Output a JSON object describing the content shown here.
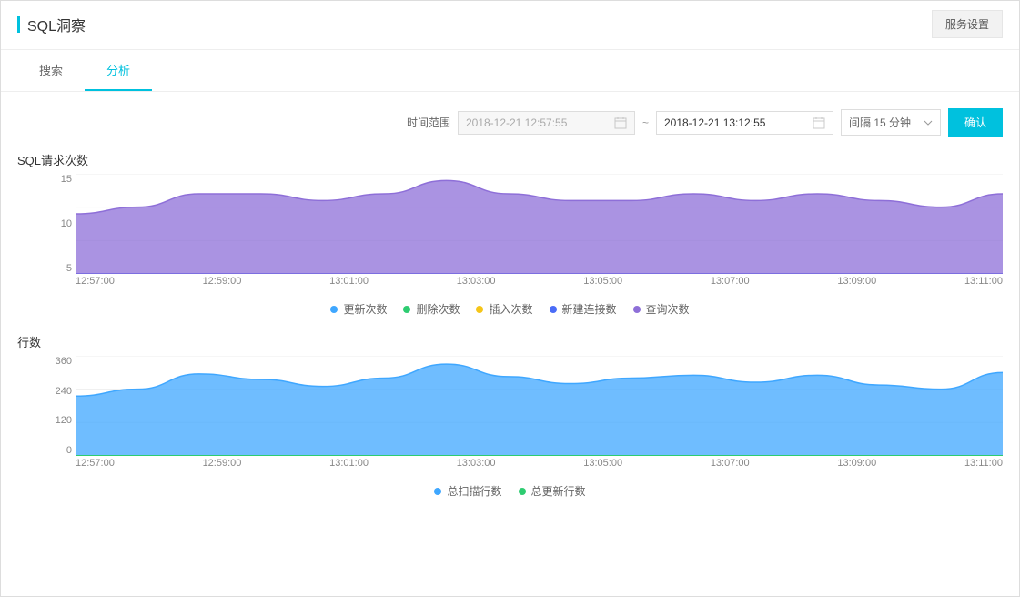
{
  "header": {
    "title": "SQL洞察",
    "service_settings": "服务设置"
  },
  "tabs": {
    "search": "搜索",
    "analyze": "分析"
  },
  "controls": {
    "time_range_label": "时间范围",
    "start_time": "2018-12-21 12:57:55",
    "end_time": "2018-12-21 13:12:55",
    "separator": "~",
    "interval_label": "间隔 15 分钟",
    "confirm": "确认"
  },
  "chart1": {
    "title": "SQL请求次数",
    "y_ticks": [
      "15",
      "10",
      "5"
    ],
    "x_ticks": [
      "12:57:00",
      "12:59:00",
      "13:01:00",
      "13:03:00",
      "13:05:00",
      "13:07:00",
      "13:09:00",
      "13:11:00"
    ],
    "legend": [
      {
        "label": "更新次数",
        "color": "#3fa7ff"
      },
      {
        "label": "删除次数",
        "color": "#2ecc71"
      },
      {
        "label": "插入次数",
        "color": "#f5c518"
      },
      {
        "label": "新建连接数",
        "color": "#4a6cf7"
      },
      {
        "label": "查询次数",
        "color": "#8e6fd8"
      }
    ]
  },
  "chart2": {
    "title": "行数",
    "y_ticks": [
      "360",
      "240",
      "120",
      "0"
    ],
    "x_ticks": [
      "12:57:00",
      "12:59:00",
      "13:01:00",
      "13:03:00",
      "13:05:00",
      "13:07:00",
      "13:09:00",
      "13:11:00"
    ],
    "legend": [
      {
        "label": "总扫描行数",
        "color": "#3fa7ff"
      },
      {
        "label": "总更新行数",
        "color": "#2ecc71"
      }
    ]
  },
  "chart_data": [
    {
      "type": "area",
      "title": "SQL请求次数",
      "xlabel": "",
      "ylabel": "",
      "ylim": [
        0,
        15
      ],
      "x": [
        "12:57:00",
        "12:58:00",
        "12:59:00",
        "13:00:00",
        "13:01:00",
        "13:02:00",
        "13:03:00",
        "13:04:00",
        "13:05:00",
        "13:06:00",
        "13:07:00",
        "13:08:00",
        "13:09:00",
        "13:10:00",
        "13:11:00",
        "13:12:00"
      ],
      "series": [
        {
          "name": "更新次数",
          "color": "#3fa7ff",
          "values": [
            0,
            0,
            0,
            0,
            0,
            0,
            0,
            0,
            0,
            0,
            0,
            0,
            0,
            0,
            0,
            0
          ]
        },
        {
          "name": "删除次数",
          "color": "#2ecc71",
          "values": [
            0,
            0,
            0,
            0,
            0,
            0,
            0,
            0,
            0,
            0,
            0,
            0,
            0,
            0,
            0,
            0
          ]
        },
        {
          "name": "插入次数",
          "color": "#f5c518",
          "values": [
            0,
            0,
            0,
            0,
            0,
            0,
            0,
            0,
            0,
            0,
            0,
            0,
            0,
            0,
            0,
            0
          ]
        },
        {
          "name": "新建连接数",
          "color": "#4a6cf7",
          "values": [
            0,
            0,
            0,
            0,
            0,
            0,
            0,
            0,
            0,
            0,
            0,
            0,
            0,
            0,
            0,
            0
          ]
        },
        {
          "name": "查询次数",
          "color": "#8e6fd8",
          "values": [
            9,
            10,
            12,
            12,
            11,
            12,
            14,
            12,
            11,
            11,
            12,
            11,
            12,
            11,
            10,
            12
          ]
        }
      ]
    },
    {
      "type": "area",
      "title": "行数",
      "xlabel": "",
      "ylabel": "",
      "ylim": [
        0,
        360
      ],
      "x": [
        "12:57:00",
        "12:58:00",
        "12:59:00",
        "13:00:00",
        "13:01:00",
        "13:02:00",
        "13:03:00",
        "13:04:00",
        "13:05:00",
        "13:06:00",
        "13:07:00",
        "13:08:00",
        "13:09:00",
        "13:10:00",
        "13:11:00",
        "13:12:00"
      ],
      "series": [
        {
          "name": "总扫描行数",
          "color": "#3fa7ff",
          "values": [
            215,
            240,
            295,
            275,
            250,
            280,
            330,
            285,
            260,
            280,
            290,
            265,
            290,
            255,
            240,
            300
          ]
        },
        {
          "name": "总更新行数",
          "color": "#2ecc71",
          "values": [
            0,
            0,
            0,
            0,
            0,
            0,
            0,
            0,
            0,
            0,
            0,
            0,
            0,
            0,
            0,
            0
          ]
        }
      ]
    }
  ]
}
